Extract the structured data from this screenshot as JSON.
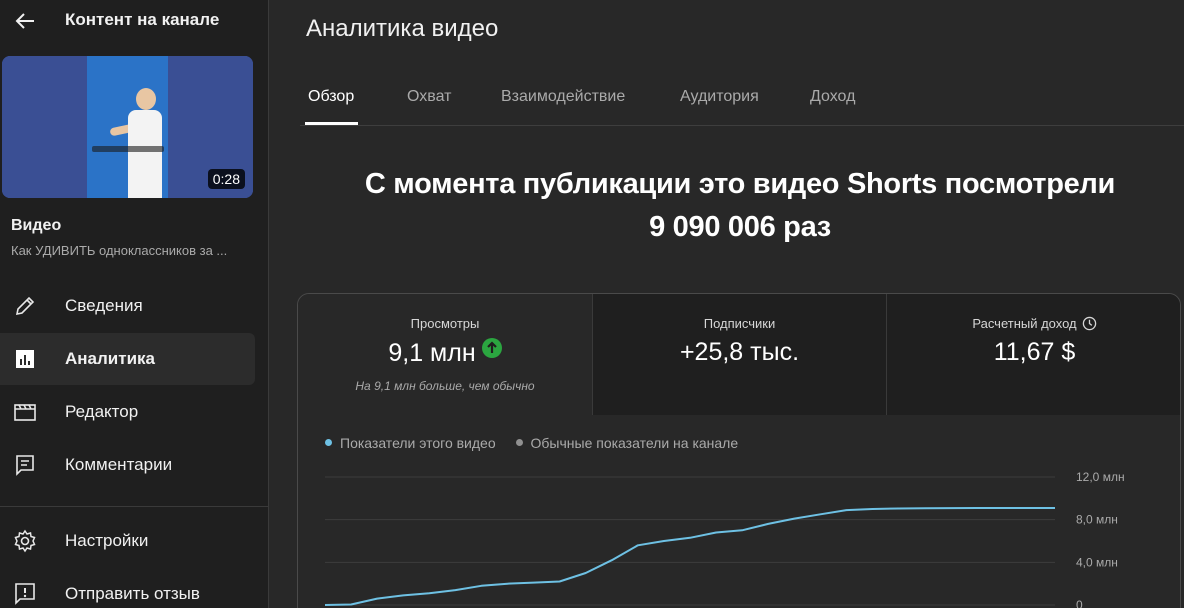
{
  "sidebar": {
    "title": "Контент на канале",
    "thumbnail": {
      "duration": "0:28"
    },
    "video_label": "Видео",
    "video_name": "Как УДИВИТЬ одноклассников за ...",
    "items": [
      {
        "label": "Сведения",
        "icon": "pencil-icon"
      },
      {
        "label": "Аналитика",
        "icon": "analytics-icon",
        "active": true
      },
      {
        "label": "Редактор",
        "icon": "clapperboard-icon"
      },
      {
        "label": "Комментарии",
        "icon": "comment-icon"
      },
      {
        "label": "Настройки",
        "icon": "gear-icon"
      },
      {
        "label": "Отправить отзыв",
        "icon": "feedback-icon"
      }
    ]
  },
  "main": {
    "title": "Аналитика видео",
    "tabs": [
      {
        "label": "Обзор",
        "active": true
      },
      {
        "label": "Охват"
      },
      {
        "label": "Взаимодействие"
      },
      {
        "label": "Аудитория"
      },
      {
        "label": "Доход"
      }
    ],
    "headline_line1": "С момента публикации это видео Shorts посмотрели",
    "headline_line2": "9 090 006 раз",
    "metrics": [
      {
        "label": "Просмотры",
        "value": "9,1 млн",
        "note": "На 9,1 млн больше, чем обычно"
      },
      {
        "label": "Подписчики",
        "value": "+25,8 тыс."
      },
      {
        "label": "Расчетный доход",
        "value": "11,67 $"
      }
    ]
  },
  "colors": {
    "accent_line": "#6ec1e4",
    "typical_dot": "#909090",
    "up_green": "#2ba640",
    "background": "#282828",
    "sidebar": "#1f1f1f"
  },
  "chart_data": {
    "type": "line",
    "legend": [
      "Показатели этого видео",
      "Обычные показатели на канале"
    ],
    "y_ticks": [
      "12,0 млн",
      "8,0 млн",
      "4,0 млн",
      "0"
    ],
    "ylim": [
      0,
      12000000
    ],
    "series": [
      {
        "name": "Показатели этого видео",
        "color": "#6ec1e4",
        "x": [
          0,
          1,
          2,
          3,
          4,
          5,
          6,
          7,
          8,
          9,
          10,
          11,
          12,
          13,
          14,
          15,
          16,
          17,
          18,
          19,
          20,
          21,
          22,
          23,
          24,
          25,
          26,
          27,
          28
        ],
        "values": [
          0,
          0.05,
          0.6,
          0.9,
          1.1,
          1.4,
          1.8,
          2.0,
          2.1,
          2.2,
          3.0,
          4.2,
          5.6,
          6.0,
          6.3,
          6.8,
          7.0,
          7.6,
          8.1,
          8.5,
          8.9,
          9.0,
          9.05,
          9.07,
          9.08,
          9.09,
          9.09,
          9.09,
          9.09
        ],
        "value_unit": "млн"
      }
    ]
  }
}
